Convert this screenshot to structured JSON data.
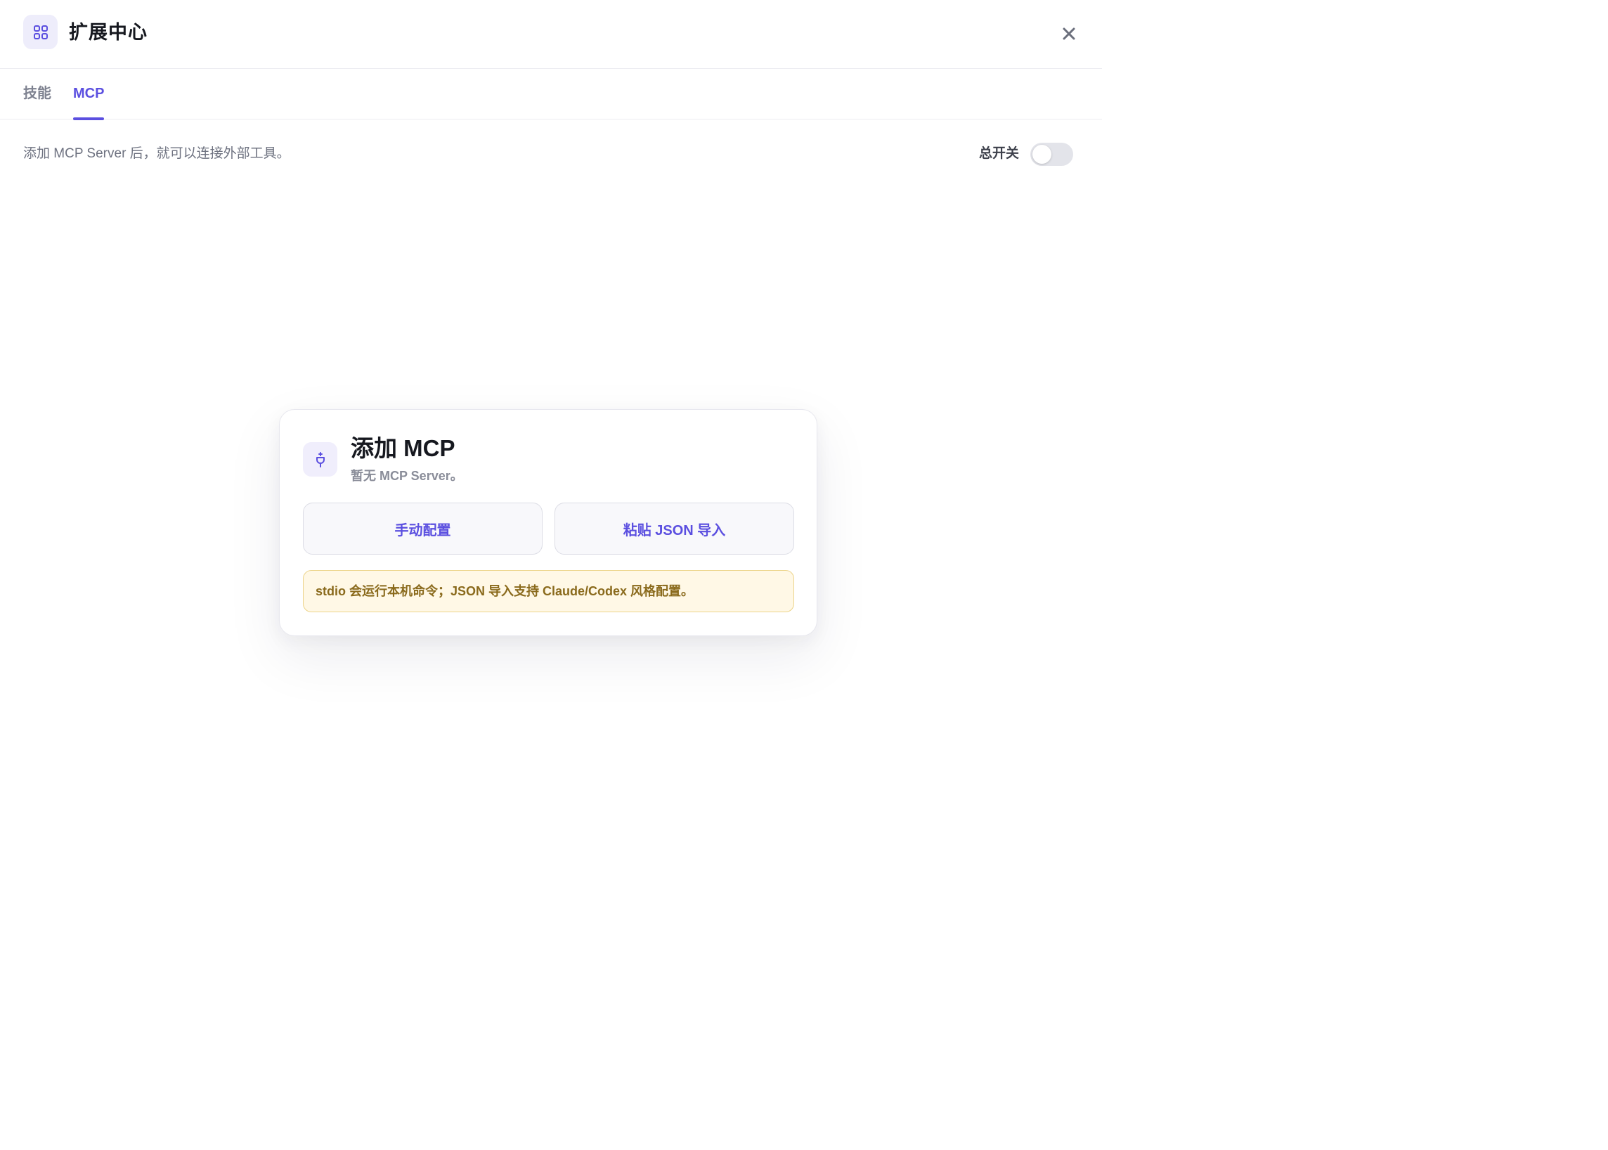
{
  "header": {
    "title": "扩展中心",
    "icon": "grid-icon",
    "close_icon": "close-icon"
  },
  "tabs": [
    {
      "label": "技能",
      "active": false
    },
    {
      "label": "MCP",
      "active": true
    }
  ],
  "info": {
    "text": "添加 MCP Server 后，就可以连接外部工具。",
    "master_switch_label": "总开关",
    "master_switch_on": false
  },
  "card": {
    "icon": "plug-icon",
    "title": "添加 MCP",
    "subtitle": "暂无 MCP Server。",
    "buttons": {
      "manual": "手动配置",
      "json_import": "粘贴 JSON 导入"
    },
    "notice": "stdio 会运行本机命令；JSON 导入支持 Claude/Codex 风格配置。"
  },
  "colors": {
    "accent": "#5b4fe0",
    "notice_bg": "#fff8e6",
    "notice_border": "#ecd48a",
    "notice_text": "#8a6a1c"
  }
}
